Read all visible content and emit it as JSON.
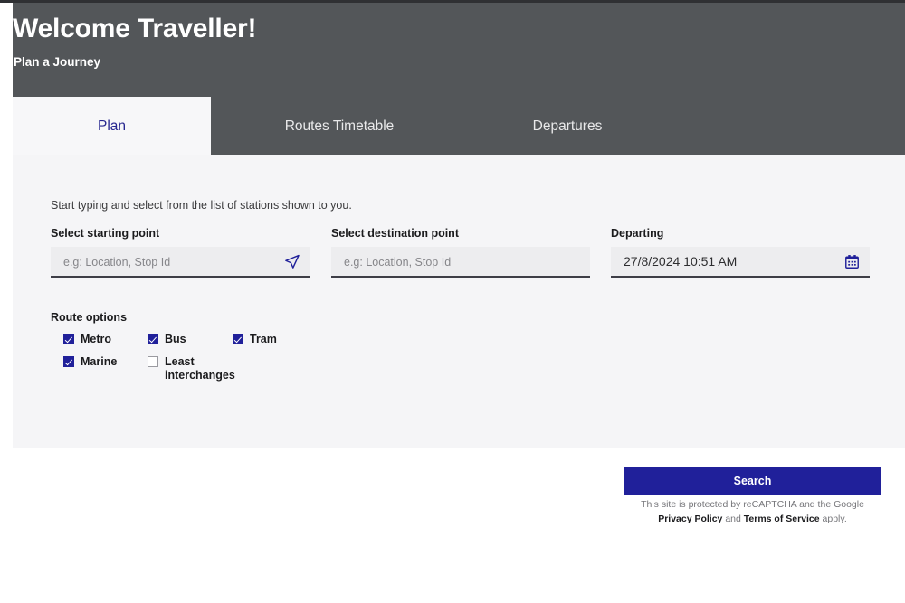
{
  "header": {
    "title": "Welcome Traveller!",
    "subtitle": "Plan a Journey"
  },
  "tabs": [
    {
      "label": "Plan",
      "active": true
    },
    {
      "label": "Routes Timetable",
      "active": false
    },
    {
      "label": "Departures",
      "active": false
    }
  ],
  "form": {
    "hint": "Start typing and select from the list of stations shown to you.",
    "start": {
      "label": "Select starting point",
      "value": "",
      "placeholder": "e.g: Location, Stop Id",
      "icon": "navigation-arrow-icon"
    },
    "destination": {
      "label": "Select destination point",
      "value": "",
      "placeholder": "e.g: Location, Stop Id"
    },
    "departing": {
      "label": "Departing",
      "value": "27/8/2024 10:51 AM",
      "placeholder": "",
      "icon": "calendar-icon"
    }
  },
  "route_options": {
    "title": "Route options",
    "items": [
      {
        "label": "Metro",
        "checked": true
      },
      {
        "label": "Bus",
        "checked": true
      },
      {
        "label": "Tram",
        "checked": true
      },
      {
        "label": "Marine",
        "checked": true
      },
      {
        "label": "Least interchanges",
        "checked": false
      }
    ]
  },
  "actions": {
    "search_label": "Search"
  },
  "recaptcha": {
    "prefix": "This site is protected by reCAPTCHA and the Google ",
    "privacy_policy": "Privacy Policy",
    "conjunction": " and ",
    "terms": "Terms of Service",
    "suffix": " apply."
  },
  "colors": {
    "header_bg": "#535659",
    "panel_bg": "#f5f5f7",
    "accent": "#20209a",
    "active_tab_text": "#26268f"
  }
}
